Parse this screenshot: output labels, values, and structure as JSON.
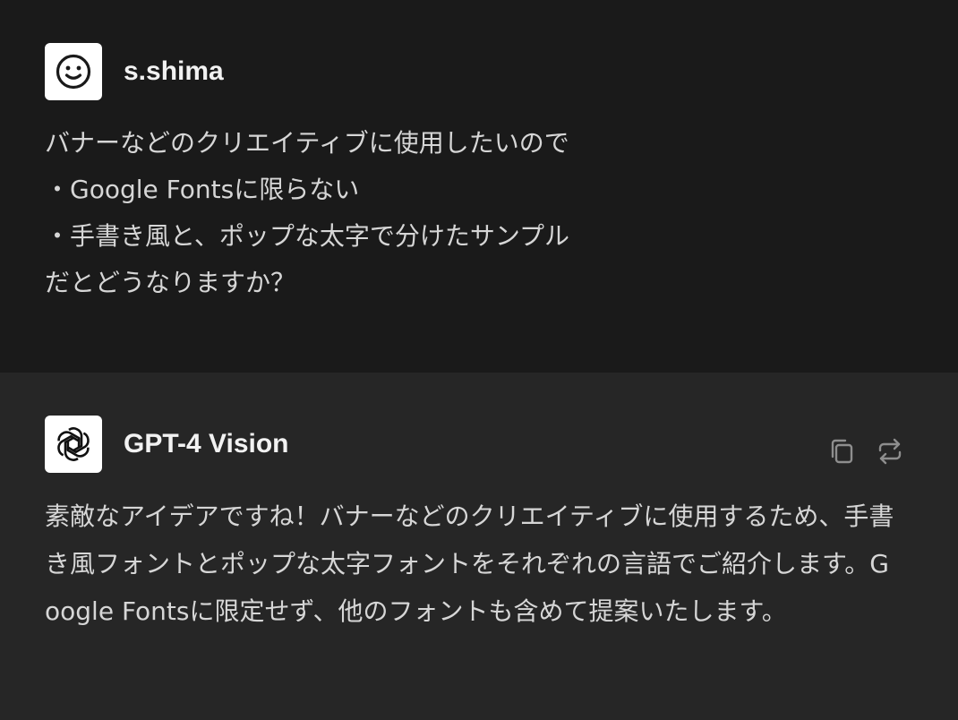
{
  "user_message": {
    "author": "s.shima",
    "avatar_icon": "smiley-icon",
    "lines": [
      "バナーなどのクリエイティブに使用したいので",
      "・Google Fontsに限らない",
      "・手書き風と、ポップな太字で分けたサンプル",
      "だとどうなりますか？"
    ]
  },
  "assistant_message": {
    "author": "GPT-4 Vision",
    "avatar_icon": "openai-logo-icon",
    "text": "素敵なアイデアですね！バナーなどのクリエイティブに使用するため、手書き風フォントとポップな太字フォントをそれぞれの言語でご紹介します。Google Fontsに限定せず、他のフォントも含めて提案いたします。",
    "actions": [
      "copy-icon",
      "regenerate-icon"
    ]
  },
  "colors": {
    "user_bg": "#1a1a1a",
    "assistant_bg": "#262626",
    "text": "#d6d6d6",
    "author": "#f2f2f2",
    "icon_muted": "#8e8e8e"
  }
}
